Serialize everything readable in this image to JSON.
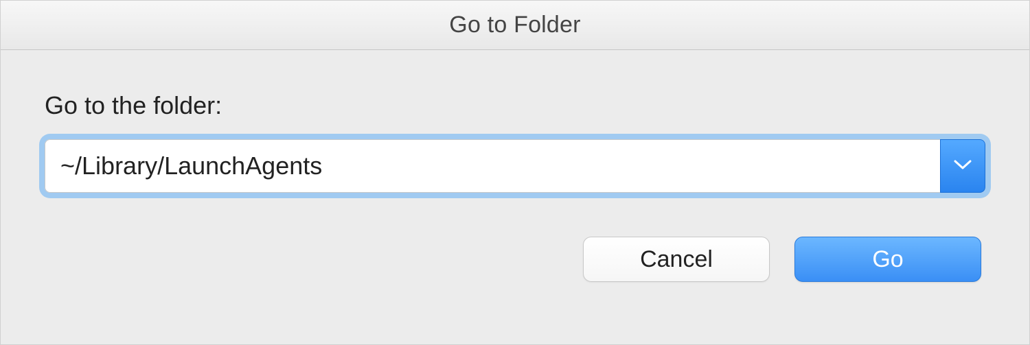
{
  "dialog": {
    "title": "Go to Folder",
    "prompt": "Go to the folder:",
    "path_value": "~/Library/LaunchAgents",
    "cancel_label": "Cancel",
    "go_label": "Go"
  }
}
